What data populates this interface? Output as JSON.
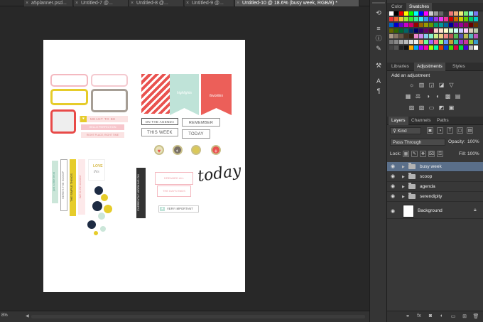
{
  "tabs": [
    {
      "label": "a5planner.psd..."
    },
    {
      "label": "Untitled-7 @..."
    },
    {
      "label": "Untitled-8 @..."
    },
    {
      "label": "Untitled-9 @..."
    },
    {
      "label": "Untitled-10 @ 18.6% (busy week, RGB/8) *"
    }
  ],
  "status": {
    "zoom": "8%"
  },
  "panel_top": {
    "tabs": [
      "Color",
      "Swatches"
    ]
  },
  "panel_mid": {
    "tabs": [
      "Libraries",
      "Adjustments",
      "Styles"
    ],
    "title": "Add an adjustment"
  },
  "panel_layers": {
    "tabs": [
      "Layers",
      "Channels",
      "Paths"
    ],
    "kind": "Kind",
    "blend": "Pass Through",
    "opacity_label": "Opacity:",
    "opacity": "100%",
    "lock_label": "Lock:",
    "fill_label": "Fill:",
    "fill": "100%",
    "layers": [
      {
        "name": "busy week"
      },
      {
        "name": "scoop"
      },
      {
        "name": "agenda"
      },
      {
        "name": "serendipity"
      }
    ],
    "background": "Background"
  },
  "doc": {
    "meant": "MEANT TO BE",
    "hello": "HELLO PERFECTION",
    "right": "RIGHT PLACE, RIGHT TIME",
    "highlights": "highlights",
    "favorites": "favorites",
    "agenda": "ON THE AGENDA",
    "remember": "REMEMBER",
    "thisweek": "THIS WEEK",
    "today": "TODAY",
    "justtreat": "just a little treat",
    "scoop": "HERE'S THE SCOOP",
    "simple": "THE SIMPLE THINGS",
    "moment": "live in the moment",
    "love": "LOVE",
    "this": "this",
    "currently": "CURRENTLY WORKING ON",
    "dreamed": "DREAMED ALL",
    "thedays": "THE DAYS ENDS",
    "important": "VERY IMPORTANT",
    "todayScript": "today"
  }
}
